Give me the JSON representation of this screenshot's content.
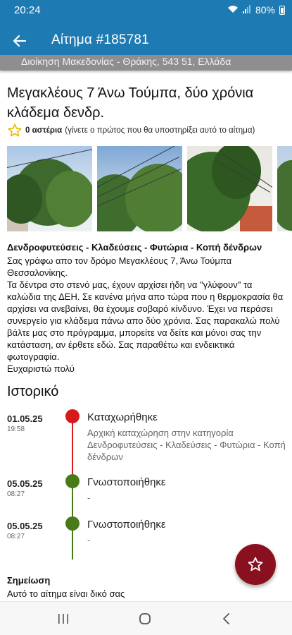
{
  "status_bar": {
    "time": "20:24",
    "battery": "80%"
  },
  "app_bar": {
    "title": "Αίτημα #185781"
  },
  "address_strip": "Διοίκηση Μακεδονίας - Θράκης, 543 51, Ελλάδα",
  "request": {
    "title": "Μεγακλέους 7 Άνω Τούμπα, δύο χρόνια κλάδεμα δενδρ.",
    "rating_count": "0 αστέρια",
    "rating_hint": "(γίνετε ο πρώτος που θα υποστηρίξει αυτό το αίτημα)",
    "photos": [
      "photo-1",
      "photo-2",
      "photo-3",
      "photo-4"
    ],
    "category": "Δενδροφυτεύσεις - Κλαδεύσεις - Φυτώρια - Κοπή δένδρων",
    "description": [
      "Σας γράφω απο τον δρόμο Μεγακλέους 7, Άνω Τούμπα Θεσσαλονίκης.",
      "Τα δέντρα στο στενό μας, έχουν αρχίσει ήδη να \"γλύφουν\" τα καλώδια της ΔΕΗ. Σε κανένα μήνα απο τώρα που η θερμοκρασία θα αρχίσει να ανεβαίνει, θα έχουμε σοβαρό κίνδυνο. Έχει να περάσει συνεργείο για κλάδεμα πάνω απο δύο χρόνια. Σας παρακαλώ πολύ βάλτε μας στο πρόγραμμα, μπορείτε να δείτε και μόνοι σας την κατάσταση, αν έρθετε εδώ. Σας παραθέτω και ενδεικτικά φωτογραφία.",
      "Ευχαριστώ πολύ"
    ]
  },
  "history": {
    "title": "Ιστορικό",
    "events": [
      {
        "date": "01.05.25",
        "time": "19:58",
        "status": "Καταχωρήθηκε",
        "description": "Αρχική καταχώρηση στην κατηγορία Δενδροφυτεύσεις - Κλαδεύσεις - Φυτώρια - Κοπή δένδρων",
        "color": "#d7191c"
      },
      {
        "date": "05.05.25",
        "time": "08:27",
        "status": "Γνωστοποιήθηκε",
        "description": "-",
        "color": "#4a7a18"
      },
      {
        "date": "05.05.25",
        "time": "08:27",
        "status": "Γνωστοποιήθηκε",
        "description": "-",
        "color": "#4a7a18"
      }
    ]
  },
  "note": {
    "label": "Σημείωση",
    "text": "Αυτό το αίτημα είναι δικό σας"
  },
  "colors": {
    "primary": "#1e7ab3",
    "fab": "#8a1020",
    "star": "#e6b800",
    "registered": "#d7191c",
    "notified": "#4a7a18"
  },
  "icons": {
    "back": "arrow-left-icon",
    "rating": "star-outline-icon",
    "fab": "star-outline-icon"
  }
}
